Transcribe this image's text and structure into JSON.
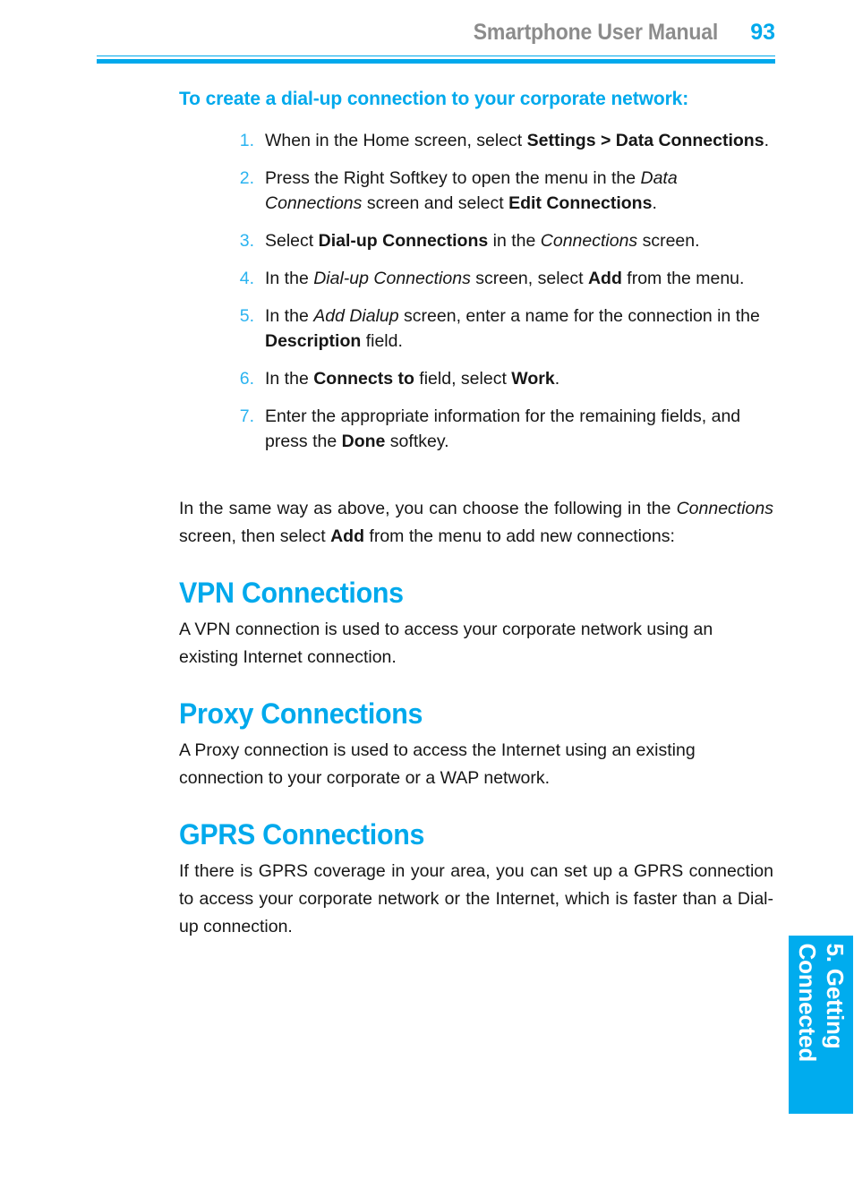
{
  "document": {
    "header_title": "Smartphone User Manual",
    "page_number": "93",
    "accent_color": "#00a9ec",
    "header_title_color": "#8c8c8c",
    "body_text_color": "#161616"
  },
  "procedure": {
    "heading": "To create a dial-up connection to your corporate network:",
    "steps": [
      {
        "number": "1.",
        "parts": [
          {
            "text": "When in the Home screen, select ",
            "style": "normal"
          },
          {
            "text": "Settings > Data Connections",
            "style": "bold"
          },
          {
            "text": ".",
            "style": "normal"
          }
        ]
      },
      {
        "number": "2.",
        "parts": [
          {
            "text": "Press the Right Softkey to open the menu in the ",
            "style": "normal"
          },
          {
            "text": "Data Connections",
            "style": "italic"
          },
          {
            "text": " screen and select ",
            "style": "normal"
          },
          {
            "text": "Edit Connections",
            "style": "bold"
          },
          {
            "text": ".",
            "style": "normal"
          }
        ]
      },
      {
        "number": "3.",
        "parts": [
          {
            "text": "Select ",
            "style": "normal"
          },
          {
            "text": "Dial-up Connections",
            "style": "bold"
          },
          {
            "text": " in the ",
            "style": "normal"
          },
          {
            "text": "Connections",
            "style": "italic"
          },
          {
            "text": " screen.",
            "style": "normal"
          }
        ]
      },
      {
        "number": "4.",
        "parts": [
          {
            "text": "In the ",
            "style": "normal"
          },
          {
            "text": "Dial-up Connections",
            "style": "italic"
          },
          {
            "text": " screen, select ",
            "style": "normal"
          },
          {
            "text": "Add",
            "style": "bold"
          },
          {
            "text": " from the menu.",
            "style": "normal"
          }
        ]
      },
      {
        "number": "5.",
        "parts": [
          {
            "text": "In the ",
            "style": "normal"
          },
          {
            "text": "Add Dialup",
            "style": "italic"
          },
          {
            "text": " screen, enter a name for the connection in the ",
            "style": "normal"
          },
          {
            "text": "Description",
            "style": "bold"
          },
          {
            "text": " field.",
            "style": "normal"
          }
        ]
      },
      {
        "number": "6.",
        "parts": [
          {
            "text": "In the ",
            "style": "normal"
          },
          {
            "text": "Connects to",
            "style": "bold"
          },
          {
            "text": " field, select ",
            "style": "normal"
          },
          {
            "text": "Work",
            "style": "bold"
          },
          {
            "text": ".",
            "style": "normal"
          }
        ]
      },
      {
        "number": "7.",
        "parts": [
          {
            "text": "Enter the appropriate information for the remaining fields, and press the ",
            "style": "normal"
          },
          {
            "text": "Done",
            "style": "bold"
          },
          {
            "text": " softkey.",
            "style": "normal"
          }
        ]
      }
    ]
  },
  "intro_paragraph": {
    "parts": [
      {
        "text": "In the same way as above, you can choose the following in the ",
        "style": "normal"
      },
      {
        "text": "Connections",
        "style": "italic"
      },
      {
        "text": " screen, then select ",
        "style": "normal"
      },
      {
        "text": "Add",
        "style": "bold"
      },
      {
        "text": " from the menu to add new connections:",
        "style": "normal"
      }
    ]
  },
  "sections": [
    {
      "heading": "VPN Connections",
      "body": "A VPN connection is used to access your corporate network using an existing Internet connection."
    },
    {
      "heading": "Proxy Connections",
      "body": "A Proxy connection is used to access the Internet using an existing connection to your corporate or a WAP network."
    },
    {
      "heading": "GPRS Connections",
      "body": "If there is GPRS coverage in your area, you can set up a GPRS connection to access your corporate network or the Internet, which is faster than a Dial-up connection."
    }
  ],
  "side_tab": {
    "line1": "5. Getting",
    "line2": "Connected",
    "background_color": "#00acee",
    "text_color": "#ffffff"
  }
}
